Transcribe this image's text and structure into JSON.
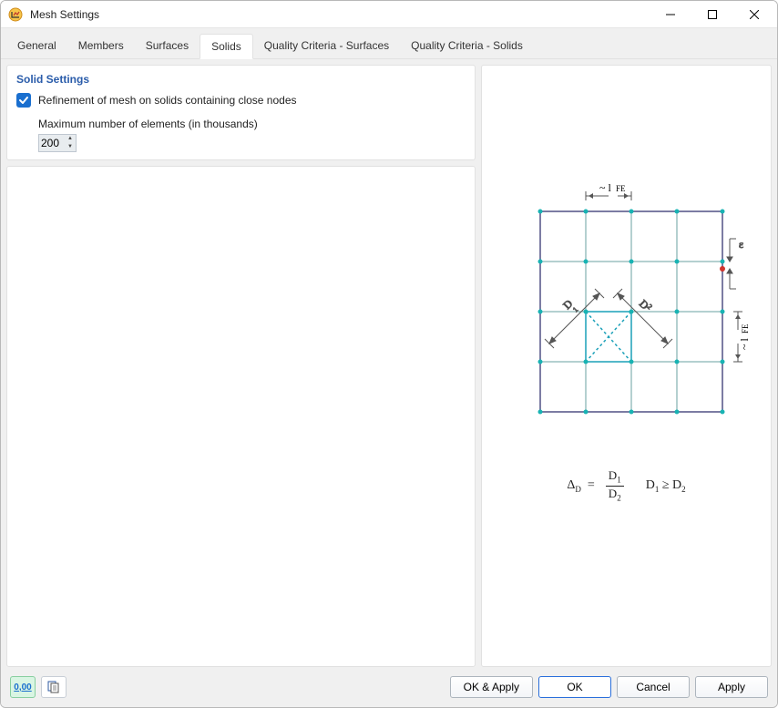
{
  "window": {
    "title": "Mesh Settings"
  },
  "tabs": [
    {
      "label": "General"
    },
    {
      "label": "Members"
    },
    {
      "label": "Surfaces"
    },
    {
      "label": "Solids",
      "active": true
    },
    {
      "label": "Quality Criteria - Surfaces"
    },
    {
      "label": "Quality Criteria - Solids"
    }
  ],
  "section": {
    "title": "Solid Settings"
  },
  "option": {
    "checkbox_label": "Refinement of mesh on solids containing close nodes",
    "checked": true,
    "field_label": "Maximum number of elements (in thousands)",
    "value": "200"
  },
  "diagram": {
    "top_label": "~ lFE",
    "right_label": "~ lFE",
    "epsilon": "ε",
    "d1": "D1",
    "d2": "D2"
  },
  "formula": {
    "delta": "Δ",
    "sub": "D",
    "eq": "=",
    "num": "D1",
    "den": "D2",
    "cond_left": "D1",
    "cond_op": "≥",
    "cond_right": "D2"
  },
  "footer": {
    "units_btn": "0,00",
    "ok_apply": "OK & Apply",
    "ok": "OK",
    "cancel": "Cancel",
    "apply": "Apply"
  }
}
